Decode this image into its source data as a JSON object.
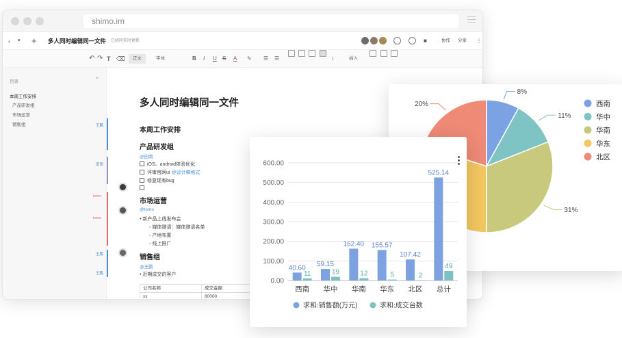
{
  "browser": {
    "url": "shimo.im",
    "doc_title": "多人同时编辑同一文件",
    "save_status": "已经同实时更新",
    "collaborate_label": "协作",
    "share_label": "分享"
  },
  "toolbar": {
    "style_label": "正文",
    "font_label": "字体",
    "insert_label": "插入"
  },
  "sidebar": {
    "title": "目录",
    "items": [
      "本周工作安排",
      "产品研发组",
      "市场运营",
      "销售组"
    ]
  },
  "editor": {
    "title": "多人同时编辑同一文件",
    "section": "本周工作安排",
    "groups": [
      {
        "heading": "产品研发组",
        "mention": "@田雨",
        "items": [
          "iOS、android体验优化",
          "评审官网ui",
          "修复现有bug"
        ],
        "inline_link": "@设计稿格式"
      },
      {
        "heading": "市场运营",
        "mention": "@tomo",
        "items": [
          "新产品上线发布会",
          "媒体邀请：媒体邀请名单",
          "产地布置",
          "线上推广"
        ]
      },
      {
        "heading": "销售组",
        "mention": "@王鹏",
        "items": [
          "近期成交的客户"
        ]
      }
    ],
    "margin_tags": [
      "王鹏",
      "田雨",
      "tomo",
      "tomo",
      "王鹏",
      "王鹏"
    ],
    "table": {
      "headers": [
        "公司名称",
        "成交金额"
      ],
      "rows": [
        [
          "xx",
          "80000"
        ]
      ]
    }
  },
  "colors": {
    "bar_sales": "#7da2e0",
    "bar_units": "#7cc2c0",
    "pie": [
      "#7ba3e3",
      "#7ec4c4",
      "#c9c97d",
      "#f2c660",
      "#ee8a76"
    ]
  },
  "chart_data": [
    {
      "type": "bar",
      "categories": [
        "西南",
        "华中",
        "华南",
        "华东",
        "北区",
        "总计"
      ],
      "series": [
        {
          "name": "求和:销售额(万元)",
          "values": [
            40.6,
            59.15,
            162.4,
            155.57,
            107.42,
            525.14
          ],
          "labels": [
            "40.60",
            "59.15",
            "162.40",
            "155.57",
            "107.42",
            "525.14"
          ]
        },
        {
          "name": "求和:成交台数",
          "values": [
            11,
            19,
            12,
            5,
            2,
            49
          ],
          "labels": [
            "11",
            "19",
            "12",
            "5",
            "2",
            "49"
          ]
        }
      ],
      "ylim": [
        0,
        600
      ],
      "yticks": [
        "0.00",
        "100.00",
        "200.00",
        "300.00",
        "400.00",
        "500.00",
        "600.00"
      ],
      "grid": true,
      "legend": "bottom"
    },
    {
      "type": "pie",
      "categories": [
        "西南",
        "华中",
        "华南",
        "华东",
        "北区"
      ],
      "values": [
        8,
        11,
        31,
        30,
        20
      ],
      "labels": [
        "8%",
        "11%",
        "31%",
        "",
        "20%"
      ],
      "legend": "right"
    }
  ]
}
